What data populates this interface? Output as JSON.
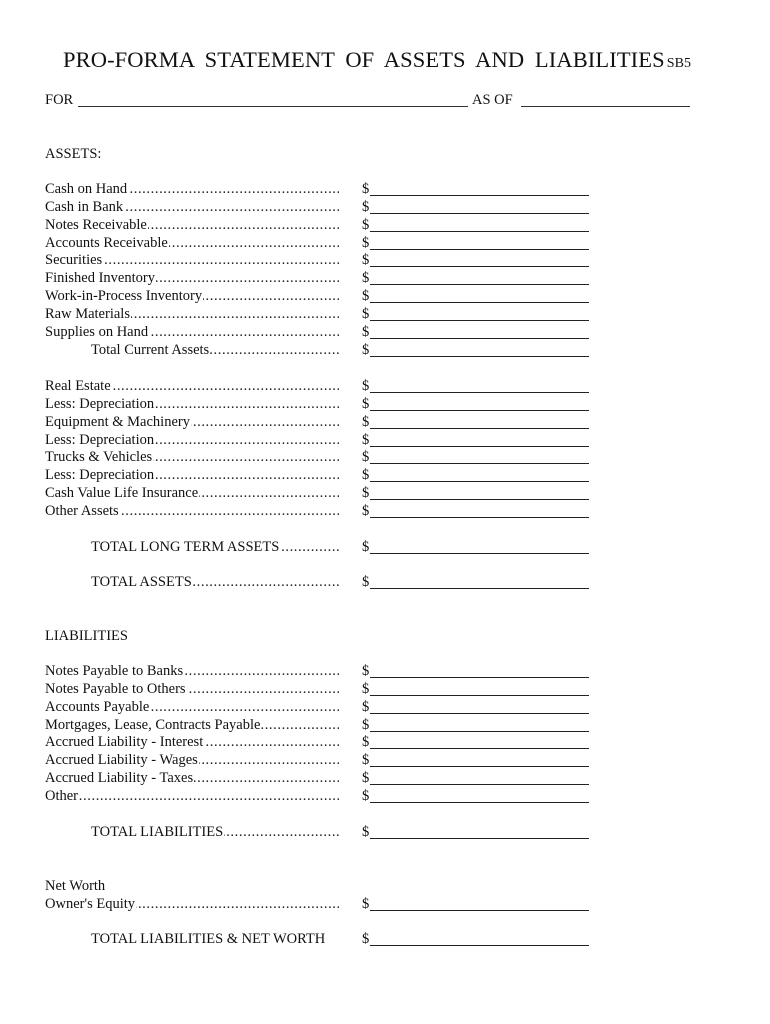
{
  "document": {
    "title": "PRO-FORMA STATEMENT OF ASSETS AND LIABILITIES",
    "form_code": "SB5",
    "for_label": "FOR",
    "for_value": "",
    "as_of_label": "AS OF",
    "as_of_value": "",
    "currency_symbol": "$"
  },
  "assets": {
    "heading": "ASSETS:",
    "current": [
      {
        "label": "Cash on Hand",
        "value": ""
      },
      {
        "label": "Cash in Bank",
        "value": ""
      },
      {
        "label": "Notes Receivable",
        "value": ""
      },
      {
        "label": "Accounts Receivable",
        "value": ""
      },
      {
        "label": "Securities",
        "value": ""
      },
      {
        "label": "Finished Inventory",
        "value": ""
      },
      {
        "label": "Work-in-Process Inventory",
        "value": ""
      },
      {
        "label": "Raw Materials",
        "value": ""
      },
      {
        "label": "Supplies on Hand",
        "value": ""
      }
    ],
    "total_current": {
      "label": "Total Current Assets",
      "value": ""
    },
    "long_term": [
      {
        "label": "Real Estate",
        "value": ""
      },
      {
        "label": "Less:  Depreciation",
        "value": ""
      },
      {
        "label": "Equipment & Machinery",
        "value": ""
      },
      {
        "label": "Less:  Depreciation",
        "value": ""
      },
      {
        "label": "Trucks & Vehicles",
        "value": ""
      },
      {
        "label": "Less:  Depreciation",
        "value": ""
      },
      {
        "label": "Cash Value Life Insurance",
        "value": ""
      },
      {
        "label": "Other Assets",
        "value": ""
      }
    ],
    "total_long_term": {
      "label": "TOTAL LONG TERM ASSETS",
      "value": ""
    },
    "total_assets": {
      "label": "TOTAL ASSETS",
      "value": ""
    }
  },
  "liabilities": {
    "heading": "LIABILITIES",
    "items": [
      {
        "label": "Notes Payable to Banks",
        "value": ""
      },
      {
        "label": "Notes Payable to Others",
        "value": ""
      },
      {
        "label": "Accounts Payable",
        "value": ""
      },
      {
        "label": "Mortgages, Lease, Contracts Payable",
        "value": ""
      },
      {
        "label": "Accrued Liability - Interest",
        "value": ""
      },
      {
        "label": "Accrued Liability - Wages",
        "value": ""
      },
      {
        "label": "Accrued Liability - Taxes",
        "value": ""
      },
      {
        "label": "Other",
        "value": ""
      }
    ],
    "total": {
      "label": "TOTAL LIABILITIES",
      "value": ""
    }
  },
  "net_worth": {
    "heading": "Net Worth",
    "owners_equity": {
      "label": "Owner's Equity",
      "value": ""
    },
    "total_liabilities_net_worth": {
      "label": "TOTAL LIABILITIES & NET WORTH",
      "value": ""
    }
  }
}
